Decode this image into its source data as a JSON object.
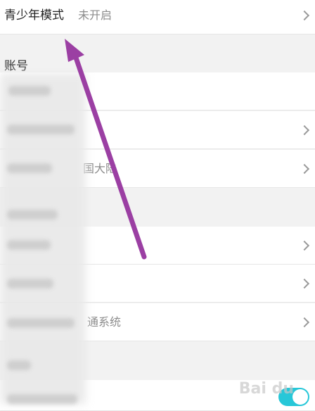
{
  "teen_mode": {
    "label": "青少年模式",
    "value": "未开启"
  },
  "account_section": {
    "title": "账号"
  },
  "rows": [
    {
      "value": ""
    },
    {
      "value": ""
    },
    {
      "value": "国大陆"
    },
    {
      "value": ""
    },
    {
      "value": ""
    },
    {
      "value": "通系统"
    }
  ],
  "watermark": {
    "text": "Bai du"
  },
  "colors": {
    "arrow": "#9b3fa3",
    "toggle": "#27c7d8"
  }
}
